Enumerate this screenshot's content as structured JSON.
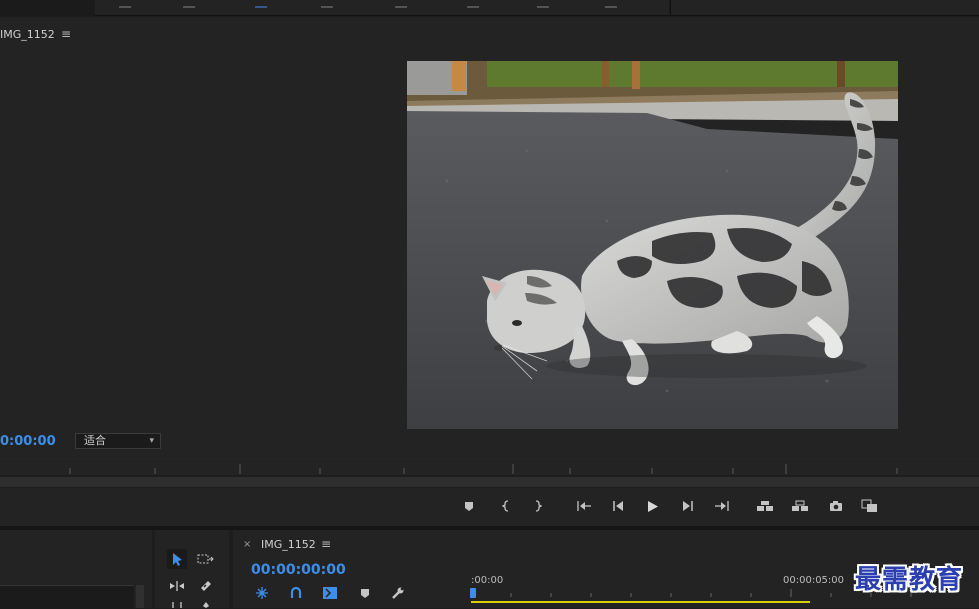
{
  "program_monitor": {
    "title": "IMG_1152",
    "menu_glyph": "≡",
    "timecode": "0:00:00",
    "fit_select": {
      "value": "适合"
    }
  },
  "timeline": {
    "close_glyph": "×",
    "title": "IMG_1152",
    "menu_glyph": "≡",
    "timecode": "00:00:00:00",
    "ruler_start": ":00:00",
    "ruler_end": "00:00:05:00"
  },
  "watermark": "最需教育",
  "colors": {
    "accent_blue": "#3d8ee8",
    "track_yellow": "#d8d000",
    "panel_bg": "#232323"
  },
  "transport_icons": [
    "add-marker-icon",
    "mark-in-icon",
    "mark-out-icon",
    "go-to-in-icon",
    "step-back-icon",
    "play-icon",
    "step-forward-icon",
    "go-to-out-icon",
    "lift-icon",
    "extract-icon",
    "export-frame-icon",
    "comparison-view-icon"
  ],
  "tool_icons": [
    "selection-tool-icon",
    "track-select-tool-icon",
    "ripple-edit-tool-icon",
    "razor-tool-icon"
  ],
  "timeline_icons": [
    "snap-icon",
    "linked-selection-icon",
    "add-edit-icon",
    "add-marker-icon",
    "wrench-icon"
  ]
}
